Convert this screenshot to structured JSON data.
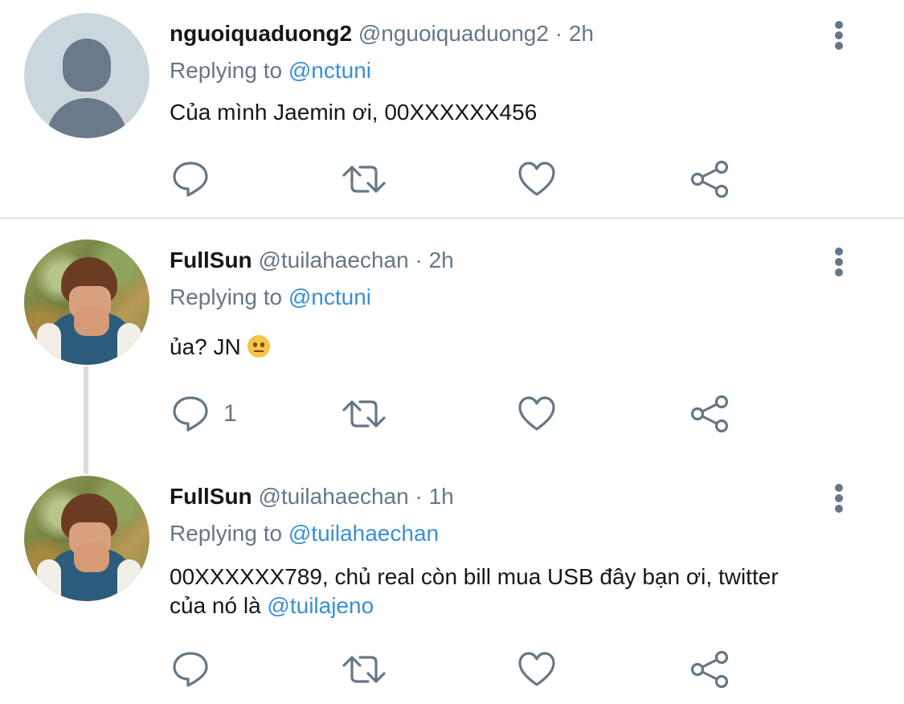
{
  "tweets": [
    {
      "name": "nguoiquaduong2",
      "handle": "@nguoiquaduong2",
      "separator": "·",
      "time": "2h",
      "replying_prefix": "Replying to",
      "replying_to": "@nctuni",
      "text": "Của mình Jaemin ơi, 00XXXXXX456",
      "reply_count": ""
    },
    {
      "name": "FullSun",
      "handle": "@tuilahaechan",
      "separator": "·",
      "time": "2h",
      "replying_prefix": "Replying to",
      "replying_to": "@nctuni",
      "text": "ủa? JN",
      "reply_count": "1"
    },
    {
      "name": "FullSun",
      "handle": "@tuilahaechan",
      "separator": "·",
      "time": "1h",
      "replying_prefix": "Replying to",
      "replying_to": "@tuilahaechan",
      "text_line1": "00XXXXXX789, chủ real còn bill mua USB đây bạn ơi, twitter",
      "text_line2_prefix": "của nó là",
      "text_line2_mention": "@tuilajeno",
      "reply_count": ""
    }
  ],
  "icons": {
    "reply": "comment-bubble-icon",
    "retweet": "retweet-icon",
    "like": "heart-icon",
    "share": "share-icon",
    "more": "more-vertical-icon",
    "emoji": "raised-eyebrow-face-emoji"
  },
  "colors": {
    "text": "#14171a",
    "secondary": "#657786",
    "link": "#3a8fd6",
    "divider": "#e6ecf0"
  }
}
